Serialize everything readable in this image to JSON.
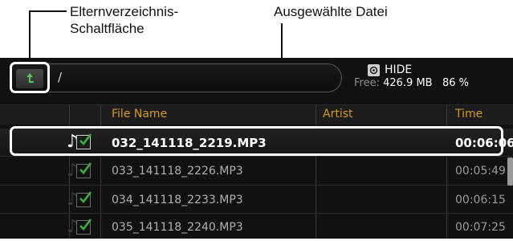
{
  "callouts": {
    "parent_folder_button": "Elternverzeichnis-\nSchaltfläche",
    "selected_file": "Ausgewählte Datei"
  },
  "path_bar": {
    "current_path": "/"
  },
  "hide_button": {
    "label": "HIDE"
  },
  "storage": {
    "free_label": "Free:",
    "free_amount": "426.9 MB",
    "free_percent": "86 %"
  },
  "table": {
    "columns": {
      "file_name": "File Name",
      "artist": "Artist",
      "time": "Time"
    },
    "rows": [
      {
        "file_name": "032_141118_2219.MP3",
        "artist": "",
        "time": "00:06:06",
        "checked": true,
        "selected": true
      },
      {
        "file_name": "033_141118_2226.MP3",
        "artist": "",
        "time": "00:05:49",
        "checked": true,
        "selected": false
      },
      {
        "file_name": "034_141118_2233.MP3",
        "artist": "",
        "time": "00:06:15",
        "checked": true,
        "selected": false
      },
      {
        "file_name": "035_141118_2240.MP3",
        "artist": "",
        "time": "00:07:25",
        "checked": true,
        "selected": false
      }
    ]
  },
  "icons": {
    "up": "up-arrow-icon",
    "note": "music-note-icon",
    "check": "checkbox-checked-icon",
    "hide": "hide-icon"
  },
  "colors": {
    "header_text": "#d39a18",
    "check_green": "#3fae3f",
    "highlight": "#ffffff",
    "panel_bg": "#111111"
  }
}
